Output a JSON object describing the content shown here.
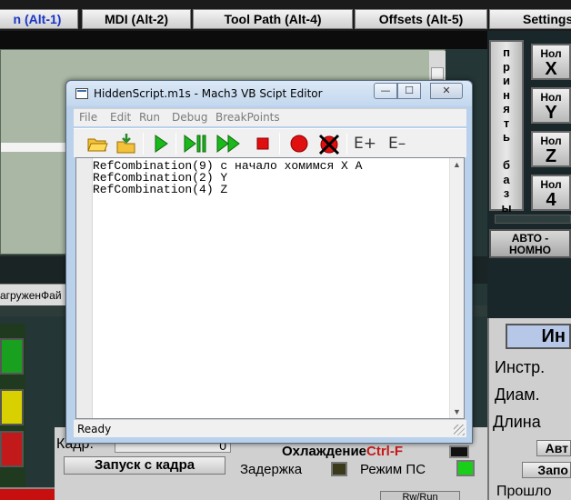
{
  "tabs": [
    {
      "label": "n (Alt-1)",
      "active": true
    },
    {
      "label": "MDI (Alt-2)",
      "active": false
    },
    {
      "label": "Tool Path (Alt-4)",
      "active": false
    },
    {
      "label": "Offsets (Alt-5)",
      "active": false
    },
    {
      "label": "Settings",
      "active": false
    }
  ],
  "background": {
    "loaded_file_label": "агруженФай",
    "kadr_label": "Кадр:",
    "kadr_value": "0",
    "run_from_line_button": "Запуск с кадра",
    "coolant_label": "Охлаждение",
    "coolant_shortcut": "Ctrl-F",
    "delay_label": "Задержка",
    "ps_mode_label": "Режим ПС",
    "bottom_button": "Rw/Run"
  },
  "right_panel": {
    "accept_bases_button": [
      "п",
      "р",
      "и",
      "н",
      "я",
      "т",
      "ь",
      " ",
      "б",
      "а",
      "з",
      "ы"
    ],
    "zero_buttons": [
      {
        "label": "Нол",
        "axis": "X"
      },
      {
        "label": "Нол",
        "axis": "Y"
      },
      {
        "label": "Нол",
        "axis": "Z"
      },
      {
        "label": "Нол",
        "axis": "4"
      }
    ],
    "auto_zero_button": [
      "АВТО -",
      "НОМНО"
    ],
    "tool_header": "Ин",
    "tool_labels": [
      "Инстр.",
      "Диам.",
      "Длина"
    ],
    "buttons": [
      "Авт",
      "Запо",
      "Прошло"
    ]
  },
  "editor_window": {
    "title": "HiddenScript.m1s - Mach3 VB Scipt Editor",
    "controls": {
      "minimize": "—",
      "maximize": "☐",
      "close": "✕"
    },
    "menu": [
      "File",
      "Edit",
      "Run",
      "Debug",
      "BreakPoints"
    ],
    "toolbar": [
      {
        "name": "open-folder-icon"
      },
      {
        "name": "save-icon"
      },
      {
        "name": "run-icon"
      },
      {
        "name": "step-pause-icon"
      },
      {
        "name": "fast-forward-icon"
      },
      {
        "name": "stop-icon"
      },
      {
        "name": "breakpoint-icon"
      },
      {
        "name": "clear-breakpoints-icon"
      },
      {
        "name": "expression-add",
        "label": "E+"
      },
      {
        "name": "expression-remove",
        "label": "E–"
      }
    ],
    "code_lines": [
      "RefCombination(9) с начало хомимся X A",
      "RefCombination(2) Y",
      "RefCombination(4) Z"
    ],
    "status": "Ready"
  },
  "colors": {
    "accent_tab_text": "#1a35c6",
    "titlebar": "#c2d7ee",
    "led_green": "#18d018",
    "coolant_red": "#c81818"
  }
}
